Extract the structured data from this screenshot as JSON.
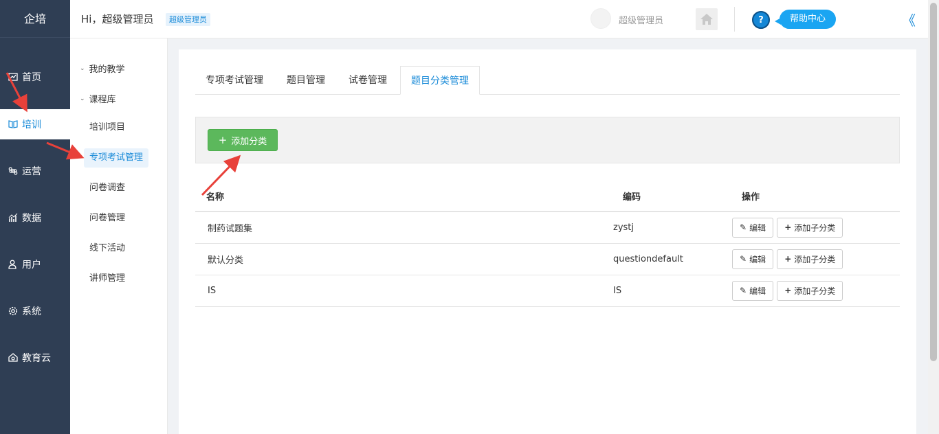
{
  "nav": {
    "brand": "企培",
    "items": [
      {
        "label": "首页",
        "icon": "chart-line-icon"
      },
      {
        "label": "培训",
        "icon": "book-icon",
        "active": true
      },
      {
        "label": "运营",
        "icon": "command-icon"
      },
      {
        "label": "数据",
        "icon": "bar-chart-icon"
      },
      {
        "label": "用户",
        "icon": "user-icon"
      },
      {
        "label": "系统",
        "icon": "gear-icon"
      },
      {
        "label": "教育云",
        "icon": "cloud-icon"
      }
    ]
  },
  "subnav": {
    "groups": [
      "我的教学",
      "课程库"
    ],
    "items": [
      "培训项目",
      "专项考试管理",
      "问卷调查",
      "问卷管理",
      "线下活动",
      "讲师管理"
    ]
  },
  "header": {
    "greeting": "Hi，超级管理员",
    "role_badge": "超级管理员",
    "user_name": "超级管理员",
    "help_label": "帮助中心",
    "help_q": "?",
    "collapse_icon": "《"
  },
  "tabs": [
    "专项考试管理",
    "题目管理",
    "试卷管理",
    "题目分类管理"
  ],
  "toolbar": {
    "add_label": "添加分类"
  },
  "table": {
    "headers": [
      "名称",
      "编码",
      "操作"
    ],
    "edit_label": "编辑",
    "add_child_label": "添加子分类",
    "rows": [
      {
        "name": "制药试题集",
        "code": "zystj"
      },
      {
        "name": "默认分类",
        "code": "questiondefault"
      },
      {
        "name": "IS",
        "code": "IS"
      }
    ]
  },
  "colors": {
    "nav_bg": "#2f3e54",
    "accent": "#1a8bd8",
    "green": "#5cb85c",
    "arrow": "#e8413a"
  }
}
